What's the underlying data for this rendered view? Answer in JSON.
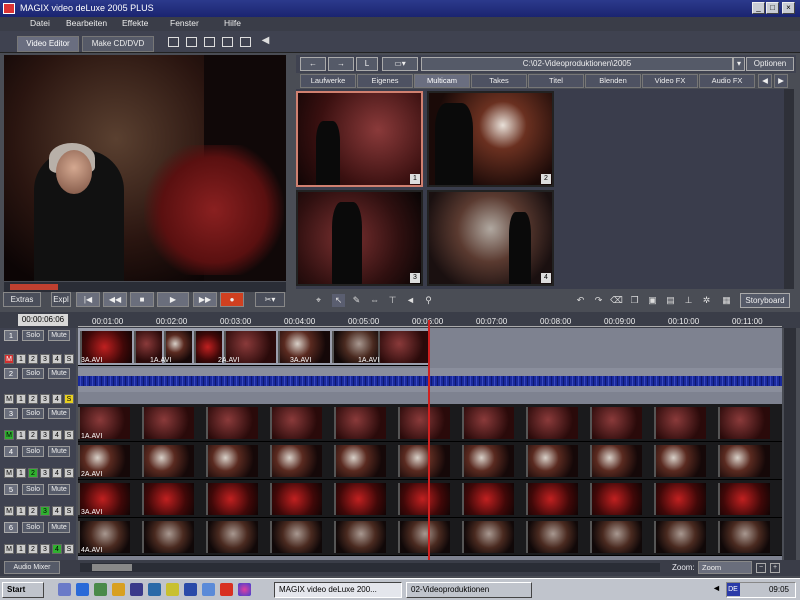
{
  "window": {
    "title": "MAGIX video deLuxe 2005 PLUS"
  },
  "menu": [
    "Datei",
    "Bearbeiten",
    "Effekte",
    "Fenster",
    "Hilfe"
  ],
  "toolbar": {
    "tab_video_editor": "Video Editor",
    "tab_make_cd": "Make CD/DVD"
  },
  "transport": {
    "extras": "Extras",
    "expl": "Expl"
  },
  "pool": {
    "path": "C:\\02-Videoproduktionen\\2005",
    "options": "Optionen",
    "tabs": [
      "Laufwerke",
      "Eigenes",
      "Multicam",
      "Takes",
      "Titel",
      "Blenden",
      "Video FX",
      "Audio FX"
    ],
    "active_tab": "Multicam",
    "thumbs": [
      "1",
      "2",
      "3",
      "4"
    ]
  },
  "storyboard": "Storyboard",
  "timeline": {
    "timecode": "00:00:06:06",
    "ticks": [
      "00:01:00",
      "00:02:00",
      "00:03:00",
      "00:04:00",
      "00:05:00",
      "00:06:00",
      "00:07:00",
      "00:08:00",
      "00:09:00",
      "00:10:00",
      "00:11:00"
    ],
    "solo": "Solo",
    "mute": "Mute",
    "tracks": [
      "1",
      "2",
      "3",
      "4",
      "5",
      "6"
    ],
    "m": "M",
    "ch": [
      "1",
      "2",
      "3",
      "4",
      "S"
    ],
    "clips": {
      "top": [
        "3A.AVI",
        "1A.AVI",
        "2A.AVI",
        "3A.AVI",
        "1A.AVI"
      ],
      "rows": [
        "1A.AVI",
        "2A.AVI",
        "3A.AVI",
        "4A.AVI"
      ]
    },
    "audio_mixer": "Audio Mixer",
    "zoom_label": "Zoom:",
    "zoom_value": "Zoom"
  },
  "taskbar": {
    "start": "Start",
    "items": [
      "MAGIX video deLuxe 200...",
      "02-Videoproduktionen"
    ],
    "lang": "DE",
    "clock": "09:05"
  }
}
